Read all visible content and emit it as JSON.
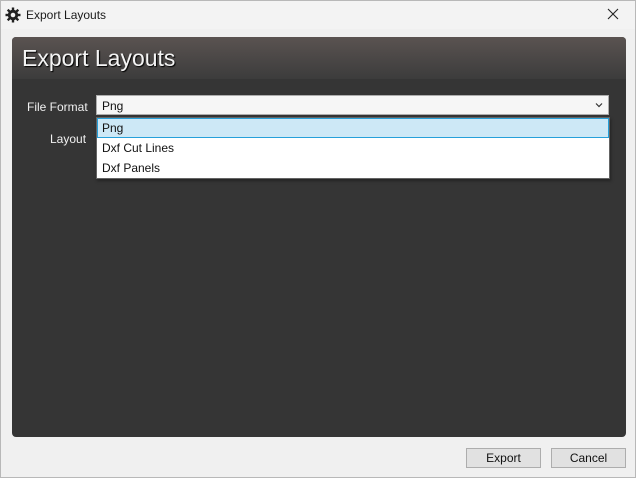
{
  "window": {
    "title": "Export Layouts",
    "icons": {
      "app": "gear-icon",
      "close": "close-icon"
    }
  },
  "panel": {
    "title": "Export Layouts"
  },
  "form": {
    "file_format_label": "File Format",
    "layout_label": "Layout",
    "file_format_value": "Png",
    "dropdown_arrow_icon": "chevron-down-icon"
  },
  "dropdown": {
    "options": [
      "Png",
      "Dxf Cut Lines",
      "Dxf Panels"
    ],
    "selected": "Png"
  },
  "buttons": {
    "export": "Export",
    "cancel": "Cancel"
  },
  "colors": {
    "panel_bg": "#353535",
    "selection_bg": "#cde8f6",
    "selection_border": "#26a0da"
  }
}
